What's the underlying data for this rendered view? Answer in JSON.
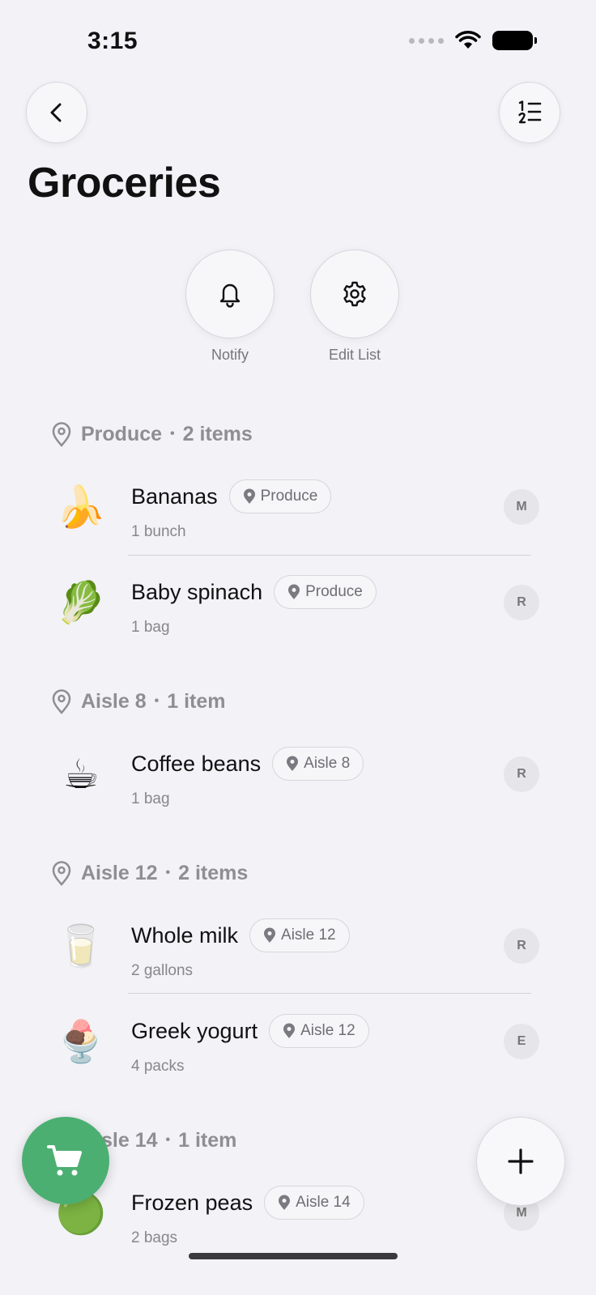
{
  "status_bar": {
    "time": "3:15"
  },
  "header": {
    "title": "Groceries"
  },
  "actions": [
    {
      "label": "Notify",
      "icon": "bell-icon"
    },
    {
      "label": "Edit List",
      "icon": "gear-icon"
    }
  ],
  "sections": [
    {
      "name": "Produce",
      "count": "2 items",
      "items": [
        {
          "name": "Bananas",
          "location": "Produce",
          "qty": "1 bunch",
          "avatar": "M",
          "emoji": "🍌"
        },
        {
          "name": "Baby spinach",
          "location": "Produce",
          "qty": "1 bag",
          "avatar": "R",
          "emoji": "🥬"
        }
      ]
    },
    {
      "name": "Aisle 8",
      "count": "1 item",
      "items": [
        {
          "name": "Coffee beans",
          "location": "Aisle 8",
          "qty": "1 bag",
          "avatar": "R",
          "emoji": "☕"
        }
      ]
    },
    {
      "name": "Aisle 12",
      "count": "2 items",
      "items": [
        {
          "name": "Whole milk",
          "location": "Aisle 12",
          "qty": "2 gallons",
          "avatar": "R",
          "emoji": "🥛"
        },
        {
          "name": "Greek yogurt",
          "location": "Aisle 12",
          "qty": "4 packs",
          "avatar": "E",
          "emoji": "🍨"
        }
      ]
    },
    {
      "name": "Aisle 14",
      "count": "1 item",
      "items": [
        {
          "name": "Frozen peas",
          "location": "Aisle 14",
          "qty": "2 bags",
          "avatar": "M",
          "emoji": "🟢"
        }
      ]
    }
  ],
  "colors": {
    "cart_fab": "#4caf72",
    "background": "#f2f2f7"
  }
}
